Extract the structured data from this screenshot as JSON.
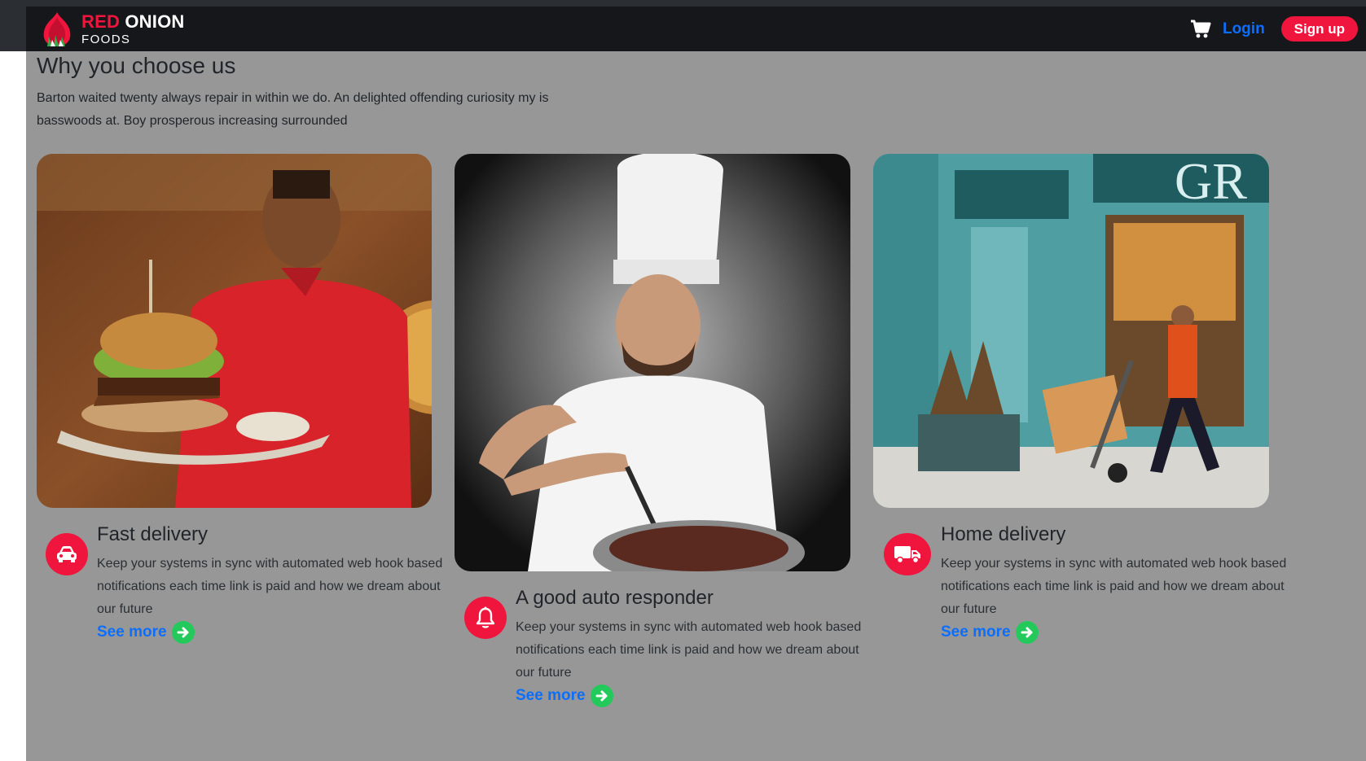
{
  "navbar": {
    "brand_part1": "RED",
    "brand_part2": "ONION",
    "brand_sub": "FOODS",
    "cart_icon": "shopping-cart-icon",
    "login_label": "Login",
    "signup_label": "Sign up"
  },
  "section": {
    "title": "Why you choose us",
    "intro": "Barton waited twenty always repair in within we do. An delighted offending curiosity my is basswoods at. Boy prosperous increasing surrounded"
  },
  "features": [
    {
      "icon": "car-icon",
      "title": "Fast delivery",
      "description": "Keep your systems in sync with automated web hook based notifications each time link is paid and how we dream about our future",
      "link": "See more"
    },
    {
      "icon": "bell-icon",
      "title": "A good auto responder",
      "description": "Keep your systems in sync with automated web hook based notifications each time link is paid and how we dream about our future",
      "link": "See more"
    },
    {
      "icon": "truck-icon",
      "title": "Home delivery",
      "description": "Keep your systems in sync with automated web hook based notifications each time link is paid and how we dream about our future",
      "link": "See more"
    }
  ],
  "colors": {
    "accent_red": "#f0153d",
    "link_blue": "#0b6efd",
    "arrow_green": "#23c95a",
    "navbar_bg": "#15171a",
    "section_bg": "#979797"
  }
}
